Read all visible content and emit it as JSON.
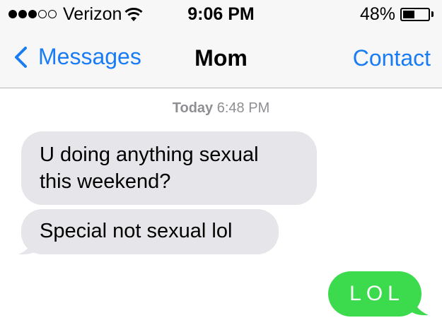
{
  "status_bar": {
    "carrier": "Verizon",
    "time": "9:06 PM",
    "battery_percent": "48%",
    "battery_level": 0.48,
    "signal_bars_filled": 3,
    "signal_bars_total": 5
  },
  "nav": {
    "back_label": "Messages",
    "title": "Mom",
    "contact_label": "Contact",
    "accent_color": "#1a7cf5"
  },
  "thread": {
    "timestamp_day": "Today",
    "timestamp_time": "6:48 PM",
    "incoming_messages": [
      {
        "line1": "U doing anything sexual",
        "line2": "this weekend?"
      },
      {
        "text": "Special not sexual lol"
      }
    ],
    "outgoing_messages": [
      {
        "text": "LOL"
      }
    ],
    "incoming_color": "#e5e5ea",
    "outgoing_color": "#3cdb4d"
  }
}
